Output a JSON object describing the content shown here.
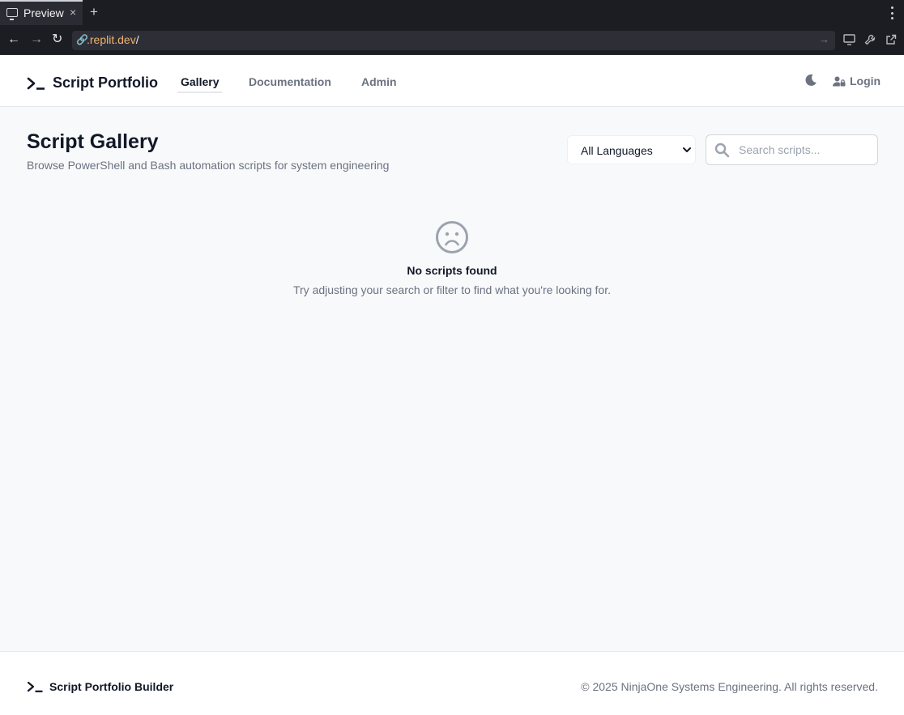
{
  "browser": {
    "tab_title": "Preview",
    "tab_close": "×",
    "new_tab": "+",
    "url_host": ".replit.dev",
    "url_path": "/"
  },
  "header": {
    "brand": "Script Portfolio",
    "nav": [
      {
        "label": "Gallery",
        "active": true
      },
      {
        "label": "Documentation",
        "active": false
      },
      {
        "label": "Admin",
        "active": false
      }
    ],
    "login_label": "Login"
  },
  "main": {
    "title": "Script Gallery",
    "subtitle": "Browse PowerShell and Bash automation scripts for system engineering",
    "language_filter": {
      "selected": "All Languages"
    },
    "search": {
      "placeholder": "Search scripts...",
      "value": ""
    },
    "empty_state": {
      "title": "No scripts found",
      "message": "Try adjusting your search or filter to find what you're looking for."
    }
  },
  "footer": {
    "brand": "Script Portfolio Builder",
    "copyright": "© 2025 NinjaOne Systems Engineering. All rights reserved."
  },
  "colors": {
    "accent_url": "#f0b36e",
    "text_primary": "#111827",
    "text_muted": "#6b7280",
    "icon_gray": "#9ca3af"
  },
  "icons": [
    "monitor-icon",
    "close-icon",
    "plus-icon",
    "kebab-icon",
    "back-arrow-icon",
    "forward-arrow-icon",
    "reload-icon",
    "link-icon",
    "arrow-right-icon",
    "devices-icon",
    "wrench-icon",
    "external-link-icon",
    "terminal-icon",
    "moon-icon",
    "user-lock-icon",
    "chevron-down-icon",
    "search-icon",
    "sad-face-icon"
  ]
}
